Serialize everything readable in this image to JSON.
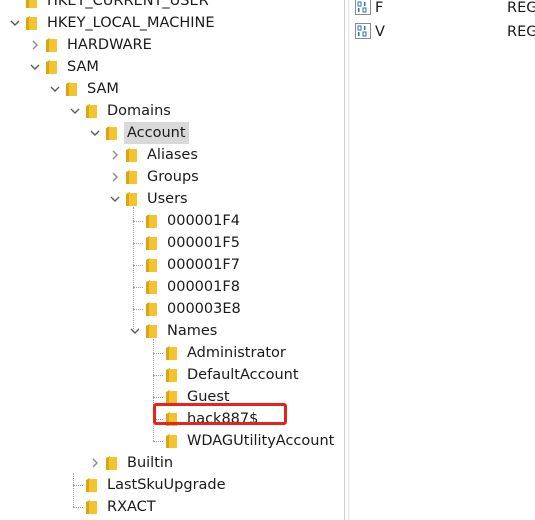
{
  "tree": {
    "nodes": [
      {
        "label": "HKEY_CURRENT_USER",
        "expander": "none",
        "selected": false
      },
      {
        "label": "HKEY_LOCAL_MACHINE",
        "expander": "expanded",
        "selected": false
      },
      {
        "label": "HARDWARE",
        "expander": "collapsed",
        "selected": false
      },
      {
        "label": "SAM",
        "expander": "expanded",
        "selected": false
      },
      {
        "label": "SAM",
        "expander": "expanded",
        "selected": false
      },
      {
        "label": "Domains",
        "expander": "expanded",
        "selected": false
      },
      {
        "label": "Account",
        "expander": "expanded",
        "selected": true
      },
      {
        "label": "Aliases",
        "expander": "collapsed",
        "selected": false
      },
      {
        "label": "Groups",
        "expander": "collapsed",
        "selected": false
      },
      {
        "label": "Users",
        "expander": "expanded",
        "selected": false
      },
      {
        "label": "000001F4",
        "expander": "none",
        "selected": false
      },
      {
        "label": "000001F5",
        "expander": "none",
        "selected": false
      },
      {
        "label": "000001F7",
        "expander": "none",
        "selected": false
      },
      {
        "label": "000001F8",
        "expander": "none",
        "selected": false
      },
      {
        "label": "000003E8",
        "expander": "none",
        "selected": false
      },
      {
        "label": "Names",
        "expander": "expanded",
        "selected": false
      },
      {
        "label": "Administrator",
        "expander": "none",
        "selected": false
      },
      {
        "label": "DefaultAccount",
        "expander": "none",
        "selected": false
      },
      {
        "label": "Guest",
        "expander": "none",
        "selected": false
      },
      {
        "label": "hack887$",
        "expander": "none",
        "selected": false
      },
      {
        "label": "WDAGUtilityAccount",
        "expander": "none",
        "selected": false
      },
      {
        "label": "Builtin",
        "expander": "collapsed",
        "selected": false
      },
      {
        "label": "LastSkuUpgrade",
        "expander": "none",
        "selected": false
      },
      {
        "label": "RXACT",
        "expander": "none",
        "selected": false
      }
    ]
  },
  "values": {
    "rows": [
      {
        "name": "F",
        "type": "REG",
        "icon": "binary-value-icon"
      },
      {
        "name": "V",
        "type": "REG",
        "icon": "binary-value-icon"
      }
    ]
  },
  "annotation": {
    "highlighted_key": "hack887$",
    "color": "#e8231a"
  },
  "colors": {
    "folder": "#f4c430",
    "folder_dark": "#dba514",
    "selection": "#d9d9d9",
    "binary_icon": "#2f6fba"
  }
}
